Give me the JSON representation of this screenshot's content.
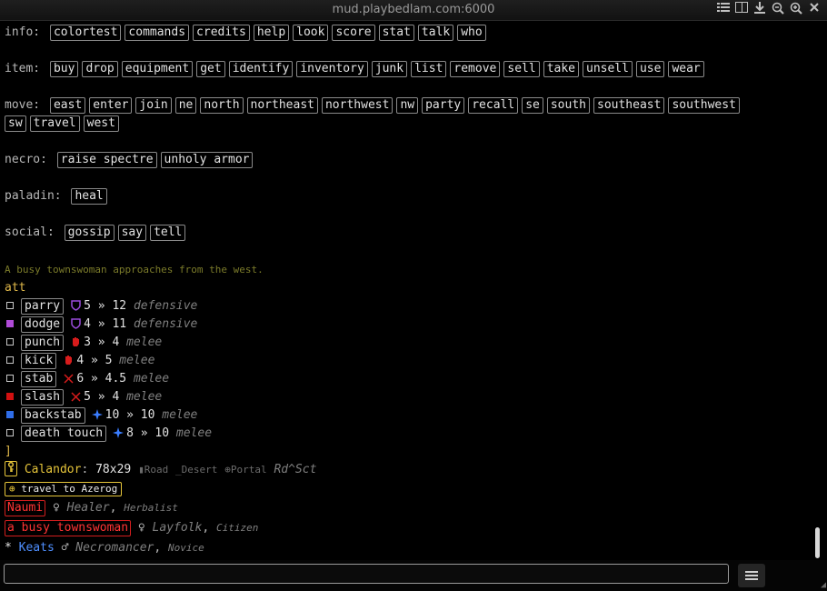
{
  "window": {
    "title": "mud.playbedlam.com:6000"
  },
  "toolbar_icons": [
    "list-icon",
    "split-icon",
    "download-icon",
    "zoom-out-icon",
    "zoom-in-icon",
    "close-icon"
  ],
  "commands": {
    "info": {
      "label": "info:",
      "items": [
        "colortest",
        "commands",
        "credits",
        "help",
        "look",
        "score",
        "stat",
        "talk",
        "who"
      ]
    },
    "item": {
      "label": "item:",
      "items": [
        "buy",
        "drop",
        "equipment",
        "get",
        "identify",
        "inventory",
        "junk",
        "list",
        "remove",
        "sell",
        "take",
        "unsell",
        "use",
        "wear"
      ]
    },
    "move": {
      "label": "move:",
      "items": [
        "east",
        "enter",
        "join",
        "ne",
        "north",
        "northeast",
        "northwest",
        "nw",
        "party",
        "recall",
        "se",
        "south",
        "southeast",
        "southwest"
      ],
      "items2": [
        "sw",
        "travel",
        "west"
      ]
    },
    "necro": {
      "label": "necro:",
      "items": [
        "raise spectre",
        "unholy armor"
      ]
    },
    "paladin": {
      "label": "paladin:",
      "items": [
        "heal"
      ]
    },
    "social": {
      "label": "social:",
      "items": [
        "gossip",
        "say",
        "tell"
      ]
    }
  },
  "message": "A busy townswoman approaches from the west.",
  "att": {
    "header": "att",
    "footer": "]",
    "sep": "»",
    "skills": [
      {
        "name": "parry",
        "a": "5",
        "b": "12",
        "type": "defensive",
        "color": "#9a4bdc",
        "icon": "shield-icon"
      },
      {
        "name": "dodge",
        "a": "4",
        "b": "11",
        "type": "defensive",
        "color": "#9a4bdc",
        "icon": "shield-icon"
      },
      {
        "name": "punch",
        "a": "3",
        "b": "4",
        "type": "melee",
        "color": "#d81c1c",
        "icon": "fist-icon"
      },
      {
        "name": "kick",
        "a": "4",
        "b": "5",
        "type": "melee",
        "color": "#d81c1c",
        "icon": "fist-icon"
      },
      {
        "name": "stab",
        "a": "6",
        "b": "4.5",
        "type": "melee",
        "color": "#d81c1c",
        "icon": "swords-icon"
      },
      {
        "name": "slash",
        "a": "5",
        "b": "4",
        "type": "melee",
        "color": "#d81c1c",
        "icon": "swords-icon"
      },
      {
        "name": "backstab",
        "a": "10",
        "b": "10",
        "type": "melee",
        "color": "#3a7dff",
        "icon": "sparkle-icon"
      },
      {
        "name": "death touch",
        "a": "8",
        "b": "10",
        "type": "melee",
        "color": "#3a7dff",
        "icon": "sparkle-icon"
      }
    ]
  },
  "location": {
    "icon": "key-icon",
    "name": "Calandor",
    "coords": "78x29",
    "road": "Road",
    "desert_glyph": "_",
    "desert": "Desert",
    "portal_glyph": "⊕",
    "portal": "Portal",
    "road_glyph": "▮",
    "code": "Rd^Sct",
    "travel_glyph": "⊕",
    "travel": "travel to Azerog"
  },
  "characters": [
    {
      "name": "Naumi",
      "gender": "♀",
      "class": "Healer",
      "rank": "Herbalist",
      "style": "redbox"
    },
    {
      "name": "a busy townswoman",
      "gender": "♀",
      "class": "Layfolk",
      "rank": "Citizen",
      "style": "redbox"
    },
    {
      "name": "Keats",
      "gender": "♂",
      "class": "Necromancer",
      "rank": "Novice",
      "style": "blue",
      "marker": "*"
    }
  ],
  "input": {
    "value": "",
    "placeholder": ""
  }
}
